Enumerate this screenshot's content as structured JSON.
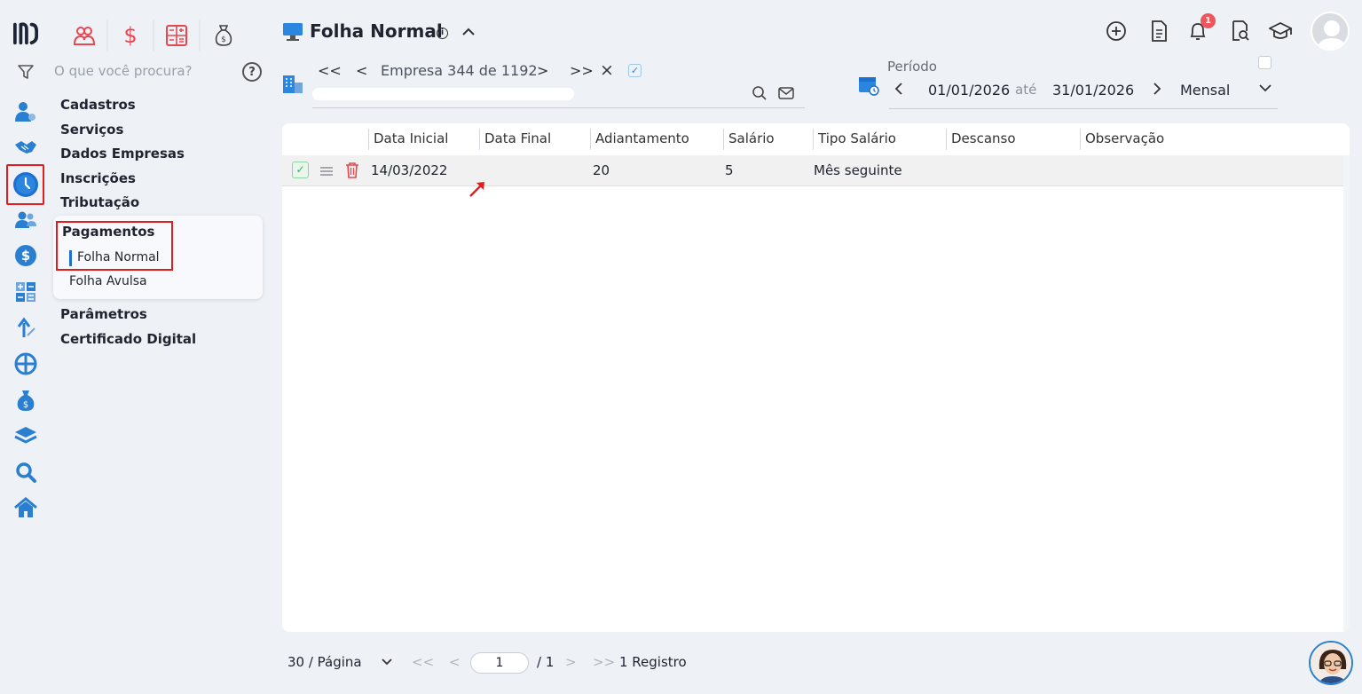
{
  "sidebar": {
    "search_placeholder": "O que você procura?",
    "help_label": "?",
    "menu": [
      "Cadastros",
      "Serviços",
      "Dados Empresas",
      "Inscrições",
      "Tributação"
    ],
    "active_group": {
      "title": "Pagamentos",
      "items": [
        "Folha Normal",
        "Folha Avulsa"
      ],
      "active_item": "Folha Normal"
    },
    "menu_after": [
      "Parâmetros",
      "Certificado Digital"
    ]
  },
  "header": {
    "title": "Folha Normal",
    "info_label": "i",
    "notifications_count": "1"
  },
  "company_nav": {
    "first_label": "<<",
    "prev_label": "<",
    "text": "Empresa 344 de 1192",
    "next_label": ">",
    "last_label": ">>",
    "clear_label": "×",
    "check_label": "✓"
  },
  "period": {
    "label": "Período",
    "from": "01/01/2026",
    "between": "até",
    "to": "31/01/2026",
    "mode": "Mensal"
  },
  "grid": {
    "columns": [
      "Data Inicial",
      "Data Final",
      "Adiantamento",
      "Salário",
      "Tipo Salário",
      "Descanso",
      "Observação"
    ],
    "rows": [
      {
        "data_inicial": "14/03/2022",
        "data_final": "",
        "adiantamento": "20",
        "salario": "5",
        "tipo_salario": "Mês seguinte",
        "descanso": "",
        "observacao": ""
      }
    ],
    "row_check": "✓"
  },
  "pager": {
    "per_page": "30 / Página",
    "first": "<<",
    "prev": "<",
    "page": "1",
    "total": "/ 1",
    "next": ">",
    "last": ">>",
    "records": "1 Registro"
  },
  "colors": {
    "accent": "#1f6fd1",
    "highlight": "#e01e1e",
    "module_icons": "#e8474f",
    "badge": "#f0545c"
  }
}
